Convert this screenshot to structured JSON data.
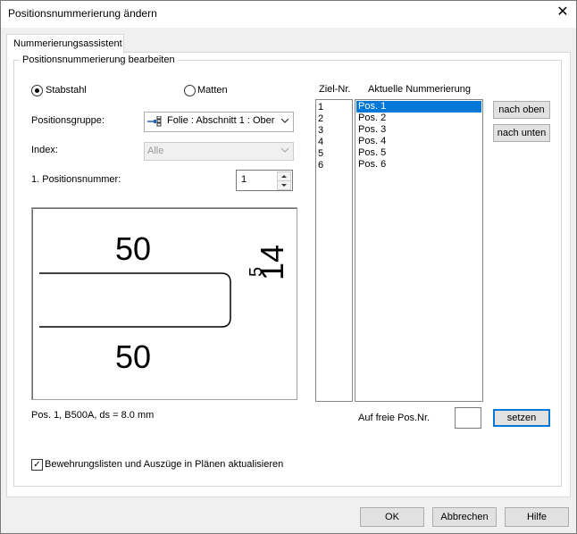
{
  "window": {
    "title": "Positionsnummerierung ändern"
  },
  "tab": {
    "label": "Nummerierungsassistent"
  },
  "group": {
    "label": "Positionsnummerierung bearbeiten"
  },
  "type_options": {
    "stabstahl": "Stabstahl",
    "matten": "Matten",
    "selected": "Stabstahl"
  },
  "positionsgruppe": {
    "label": "Positionsgruppe:",
    "value": "Folie : Abschnitt 1 : Ober"
  },
  "index": {
    "label": "Index:",
    "value": "Alle"
  },
  "first_number": {
    "label": "1. Positionsnummer:",
    "value": "1"
  },
  "preview": {
    "dim_top": "50",
    "dim_bottom": "50",
    "dim_side": "14",
    "dim_side_sup": "5"
  },
  "info_text": "Pos. 1, B500A, ds = 8.0 mm",
  "lists": {
    "ziel_header": "Ziel-Nr.",
    "aktuelle_header": "Aktuelle Nummerierung",
    "ziel": [
      "1",
      "2",
      "3",
      "4",
      "5",
      "6"
    ],
    "aktuelle": [
      "Pos. 1",
      "Pos. 2",
      "Pos. 3",
      "Pos. 4",
      "Pos. 5",
      "Pos. 6"
    ],
    "selected_index": 0
  },
  "buttons": {
    "nach_oben": "nach oben",
    "nach_unten": "nach unten",
    "setzen": "setzen",
    "ok": "OK",
    "abbrechen": "Abbrechen",
    "hilfe": "Hilfe"
  },
  "free_pos": {
    "label": "Auf freie Pos.Nr.",
    "value": ""
  },
  "update_checkbox": {
    "label": "Bewehrungslisten und Auszüge in Plänen aktualisieren",
    "checked": true
  }
}
